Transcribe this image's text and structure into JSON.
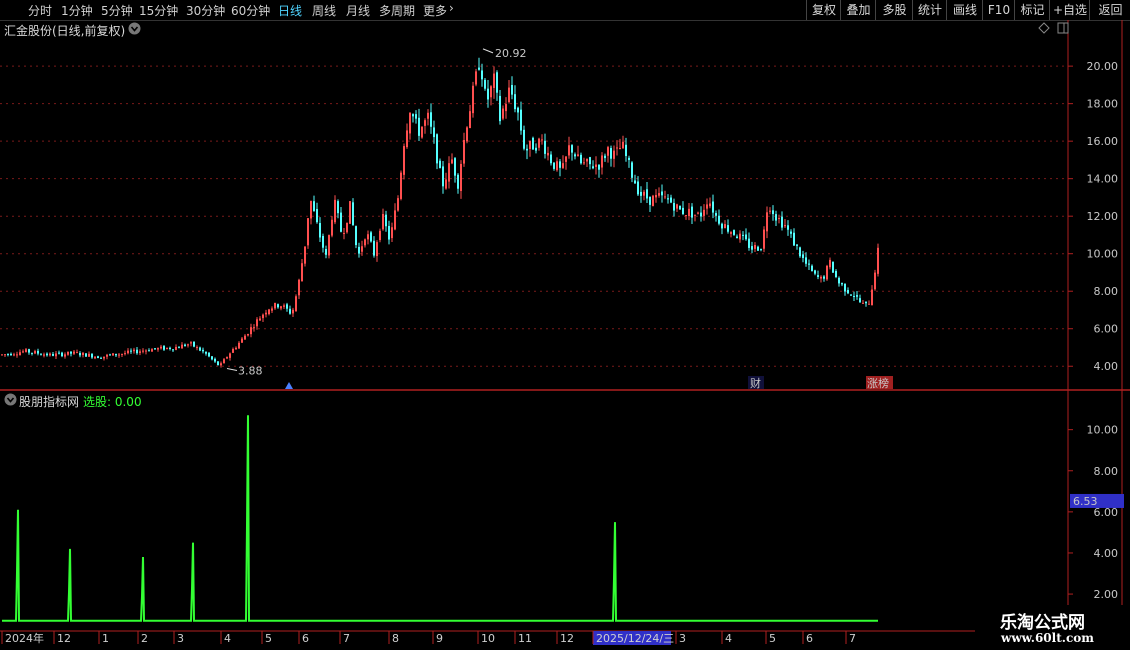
{
  "toolbar": {
    "periods": [
      "分时",
      "1分钟",
      "5分钟",
      "15分钟",
      "30分钟",
      "60分钟",
      "日线",
      "周线",
      "月线",
      "多周期",
      "更多"
    ],
    "active": "日线",
    "buttons": [
      "复权",
      "叠加",
      "多股",
      "统计",
      "画线",
      "F10",
      "标记",
      "+自选",
      "返回"
    ]
  },
  "main_panel": {
    "title": "汇金股份(日线,前复权)"
  },
  "sub_panel": {
    "title": "股朋指标网",
    "indicator": "选股: 0.00"
  },
  "watermark": {
    "title": "乐淘公式网",
    "url": "www.60lt.com"
  },
  "colors": {
    "up": "#ff4f4f",
    "down": "#54ffff",
    "indicator": "#33ff33",
    "grid": "#7a1a1a",
    "axis_line": "#b02020",
    "highlight": "#3030c8"
  },
  "chart_data": [
    {
      "type": "candlestick",
      "name": "price",
      "ylim": [
        3.0,
        21.5
      ],
      "yticks": [
        "4.00",
        "6.00",
        "8.00",
        "10.00",
        "12.00",
        "14.00",
        "16.00",
        "18.00",
        "20.00"
      ],
      "ytick_values": [
        4,
        6,
        8,
        10,
        12,
        14,
        16,
        18,
        20
      ],
      "grid": true,
      "annotations": {
        "high": "20.92",
        "low": "3.88"
      },
      "markers": {
        "finance": "财",
        "limit": "涨榜"
      },
      "trend": [
        [
          0,
          4.6
        ],
        [
          25,
          4.8
        ],
        [
          50,
          4.6
        ],
        [
          75,
          4.7
        ],
        [
          100,
          4.5
        ],
        [
          125,
          4.7
        ],
        [
          150,
          4.9
        ],
        [
          175,
          5.0
        ],
        [
          190,
          5.2
        ],
        [
          205,
          4.7
        ],
        [
          215,
          4.2
        ],
        [
          220,
          4.0
        ],
        [
          228,
          4.6
        ],
        [
          240,
          5.3
        ],
        [
          255,
          6.3
        ],
        [
          268,
          7.1
        ],
        [
          280,
          7.3
        ],
        [
          292,
          6.8
        ],
        [
          298,
          8.2
        ],
        [
          305,
          10.5
        ],
        [
          310,
          13.0
        ],
        [
          318,
          11.3
        ],
        [
          326,
          9.8
        ],
        [
          334,
          12.8
        ],
        [
          342,
          11.0
        ],
        [
          350,
          12.5
        ],
        [
          358,
          9.8
        ],
        [
          366,
          11.2
        ],
        [
          374,
          10.0
        ],
        [
          382,
          12.0
        ],
        [
          390,
          10.7
        ],
        [
          398,
          13.0
        ],
        [
          404,
          16.0
        ],
        [
          410,
          17.8
        ],
        [
          418,
          16.5
        ],
        [
          428,
          17.2
        ],
        [
          436,
          15.5
        ],
        [
          442,
          13.6
        ],
        [
          452,
          15.0
        ],
        [
          458,
          13.8
        ],
        [
          466,
          16.8
        ],
        [
          474,
          18.8
        ],
        [
          480,
          20.5
        ],
        [
          486,
          18.0
        ],
        [
          494,
          19.2
        ],
        [
          500,
          17.2
        ],
        [
          510,
          18.8
        ],
        [
          518,
          17.5
        ],
        [
          525,
          15.5
        ],
        [
          533,
          15.8
        ],
        [
          542,
          16.0
        ],
        [
          552,
          14.9
        ],
        [
          562,
          14.3
        ],
        [
          570,
          15.8
        ],
        [
          580,
          14.8
        ],
        [
          590,
          14.7
        ],
        [
          600,
          14.8
        ],
        [
          608,
          15.6
        ],
        [
          615,
          15.2
        ],
        [
          622,
          15.8
        ],
        [
          630,
          14.5
        ],
        [
          640,
          13.2
        ],
        [
          650,
          12.9
        ],
        [
          660,
          13.0
        ],
        [
          670,
          12.8
        ],
        [
          680,
          12.3
        ],
        [
          690,
          12.2
        ],
        [
          700,
          12.0
        ],
        [
          708,
          13.0
        ],
        [
          716,
          12.0
        ],
        [
          724,
          11.5
        ],
        [
          732,
          11.2
        ],
        [
          742,
          10.8
        ],
        [
          752,
          10.3
        ],
        [
          762,
          10.4
        ],
        [
          768,
          12.8
        ],
        [
          776,
          12.0
        ],
        [
          785,
          11.5
        ],
        [
          795,
          10.5
        ],
        [
          805,
          9.5
        ],
        [
          815,
          8.8
        ],
        [
          822,
          8.6
        ],
        [
          830,
          9.5
        ],
        [
          838,
          8.5
        ],
        [
          846,
          8.1
        ],
        [
          854,
          7.8
        ],
        [
          862,
          7.3
        ],
        [
          868,
          7.2
        ],
        [
          872,
          8.2
        ],
        [
          878,
          10.1
        ]
      ]
    },
    {
      "type": "spike_line",
      "name": "indicator",
      "ylim": [
        0.3,
        11.2
      ],
      "yticks": [
        "2.00",
        "4.00",
        "6.00",
        "8.00",
        "10.00"
      ],
      "ytick_values": [
        2,
        4,
        6,
        8,
        10
      ],
      "current_value": "6.53",
      "baseline": 0.7,
      "spikes": [
        [
          18,
          6.1
        ],
        [
          70,
          4.2
        ],
        [
          143,
          3.8
        ],
        [
          193,
          4.5
        ],
        [
          248,
          10.7
        ],
        [
          615,
          5.5
        ]
      ],
      "x_labels": [
        "2024年",
        "12",
        "1",
        "2",
        "3",
        "4",
        "5",
        "6",
        "7",
        "8",
        "9",
        "10",
        "11",
        "12",
        "2025/12/24/三",
        "3",
        "4",
        "5",
        "6",
        "7"
      ],
      "highlight_label": "2025/12/24/三"
    }
  ]
}
